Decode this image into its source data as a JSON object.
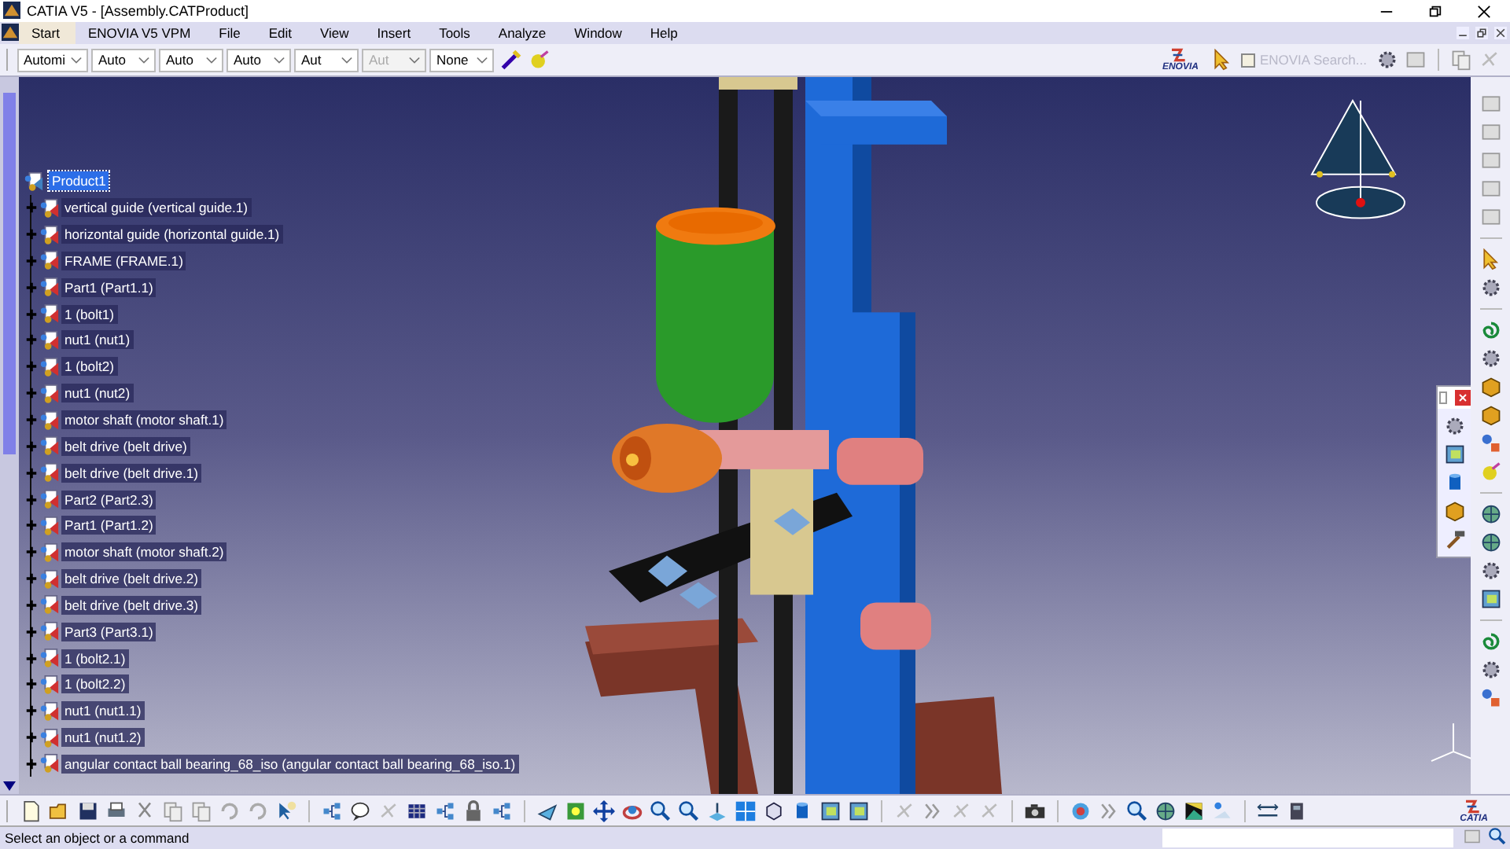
{
  "window": {
    "title": "CATIA V5 - [Assembly.CATProduct]"
  },
  "menu": [
    {
      "label": "Start",
      "selected": true
    },
    {
      "label": "ENOVIA V5 VPM",
      "selected": false
    },
    {
      "label": "File",
      "selected": false
    },
    {
      "label": "Edit",
      "selected": false
    },
    {
      "label": "View",
      "selected": false
    },
    {
      "label": "Insert",
      "selected": false
    },
    {
      "label": "Tools",
      "selected": false
    },
    {
      "label": "Analyze",
      "selected": false
    },
    {
      "label": "Window",
      "selected": false
    },
    {
      "label": "Help",
      "selected": false
    }
  ],
  "dropdowns": [
    {
      "value": "Automi",
      "disabled": false
    },
    {
      "value": "Auto",
      "disabled": false
    },
    {
      "value": "Auto",
      "disabled": false
    },
    {
      "value": "Auto",
      "disabled": false
    },
    {
      "value": "Aut",
      "disabled": false
    },
    {
      "value": "Aut",
      "disabled": true
    },
    {
      "value": "None",
      "disabled": false
    }
  ],
  "enovia": {
    "logo": "ENOVIA",
    "search_label": "ENOVIA Search...",
    "checked": false,
    "disabled": true
  },
  "tree": {
    "label": "Product1",
    "selected": true,
    "children": [
      {
        "label": "vertical guide (vertical guide.1)",
        "selected": false,
        "expanded": false
      },
      {
        "label": "horizontal guide (horizontal guide.1)",
        "selected": false,
        "expanded": false
      },
      {
        "label": "FRAME (FRAME.1)",
        "selected": false,
        "expanded": false
      },
      {
        "label": "Part1 (Part1.1)",
        "selected": false,
        "expanded": false
      },
      {
        "label": "1 (bolt1)",
        "selected": false,
        "expanded": false
      },
      {
        "label": "nut1 (nut1)",
        "selected": false,
        "expanded": false
      },
      {
        "label": "1 (bolt2)",
        "selected": false,
        "expanded": false
      },
      {
        "label": "nut1 (nut2)",
        "selected": false,
        "expanded": false
      },
      {
        "label": "motor shaft (motor shaft.1)",
        "selected": false,
        "expanded": false
      },
      {
        "label": "belt drive (belt drive)",
        "selected": false,
        "expanded": false
      },
      {
        "label": "belt drive (belt drive.1)",
        "selected": false,
        "expanded": false
      },
      {
        "label": "Part2 (Part2.3)",
        "selected": false,
        "expanded": false
      },
      {
        "label": "Part1 (Part1.2)",
        "selected": false,
        "expanded": false
      },
      {
        "label": "motor shaft (motor shaft.2)",
        "selected": false,
        "expanded": false
      },
      {
        "label": "belt drive (belt drive.2)",
        "selected": false,
        "expanded": false
      },
      {
        "label": "belt drive (belt drive.3)",
        "selected": false,
        "expanded": false
      },
      {
        "label": "Part3 (Part3.1)",
        "selected": false,
        "expanded": false
      },
      {
        "label": "1 (bolt2.1)",
        "selected": false,
        "expanded": false
      },
      {
        "label": "1 (bolt2.2)",
        "selected": false,
        "expanded": false
      },
      {
        "label": "nut1 (nut1.1)",
        "selected": false,
        "expanded": false
      },
      {
        "label": "nut1 (nut1.2)",
        "selected": false,
        "expanded": false
      },
      {
        "label": "angular contact ball bearing_68_iso (angular contact ball bearing_68_iso.1)",
        "selected": false,
        "expanded": false
      }
    ]
  },
  "catia_logo": "CATIA",
  "status_bar": {
    "message": "Select an object or a command"
  }
}
